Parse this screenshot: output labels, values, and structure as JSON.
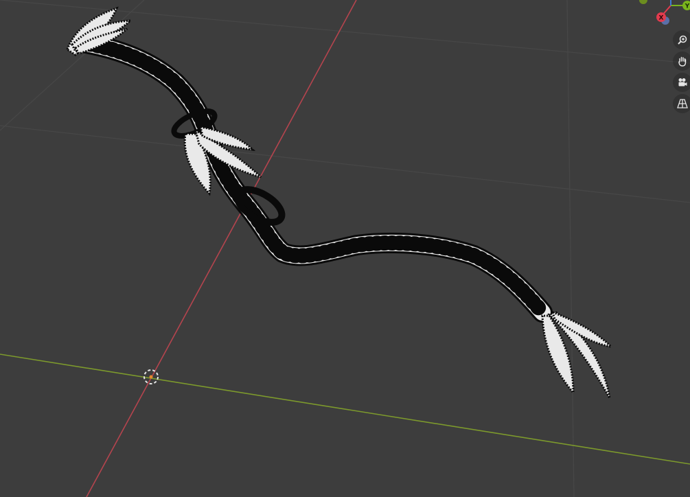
{
  "viewport": {
    "background_color": "#3d3d3d",
    "grid_color": "#474747",
    "x_axis_color": "#b5444e",
    "y_axis_color": "#7d9a2c",
    "object_face_color": "#e9e9e9",
    "vertex_color": "#0a0a0a"
  },
  "gizmo": {
    "x_label": "X",
    "y_label": "Y",
    "x_color": "#e23b4e",
    "y_color": "#7ab51d"
  },
  "navigation": {
    "items": [
      {
        "name": "zoom",
        "icon": "zoom-icon"
      },
      {
        "name": "pan",
        "icon": "hand-icon"
      },
      {
        "name": "camera",
        "icon": "camera-icon"
      },
      {
        "name": "perspective",
        "icon": "perspective-grid-icon"
      }
    ]
  },
  "cursor_3d": {
    "ring_color": "#e6e6e6",
    "dash_color": "#d9433b"
  }
}
